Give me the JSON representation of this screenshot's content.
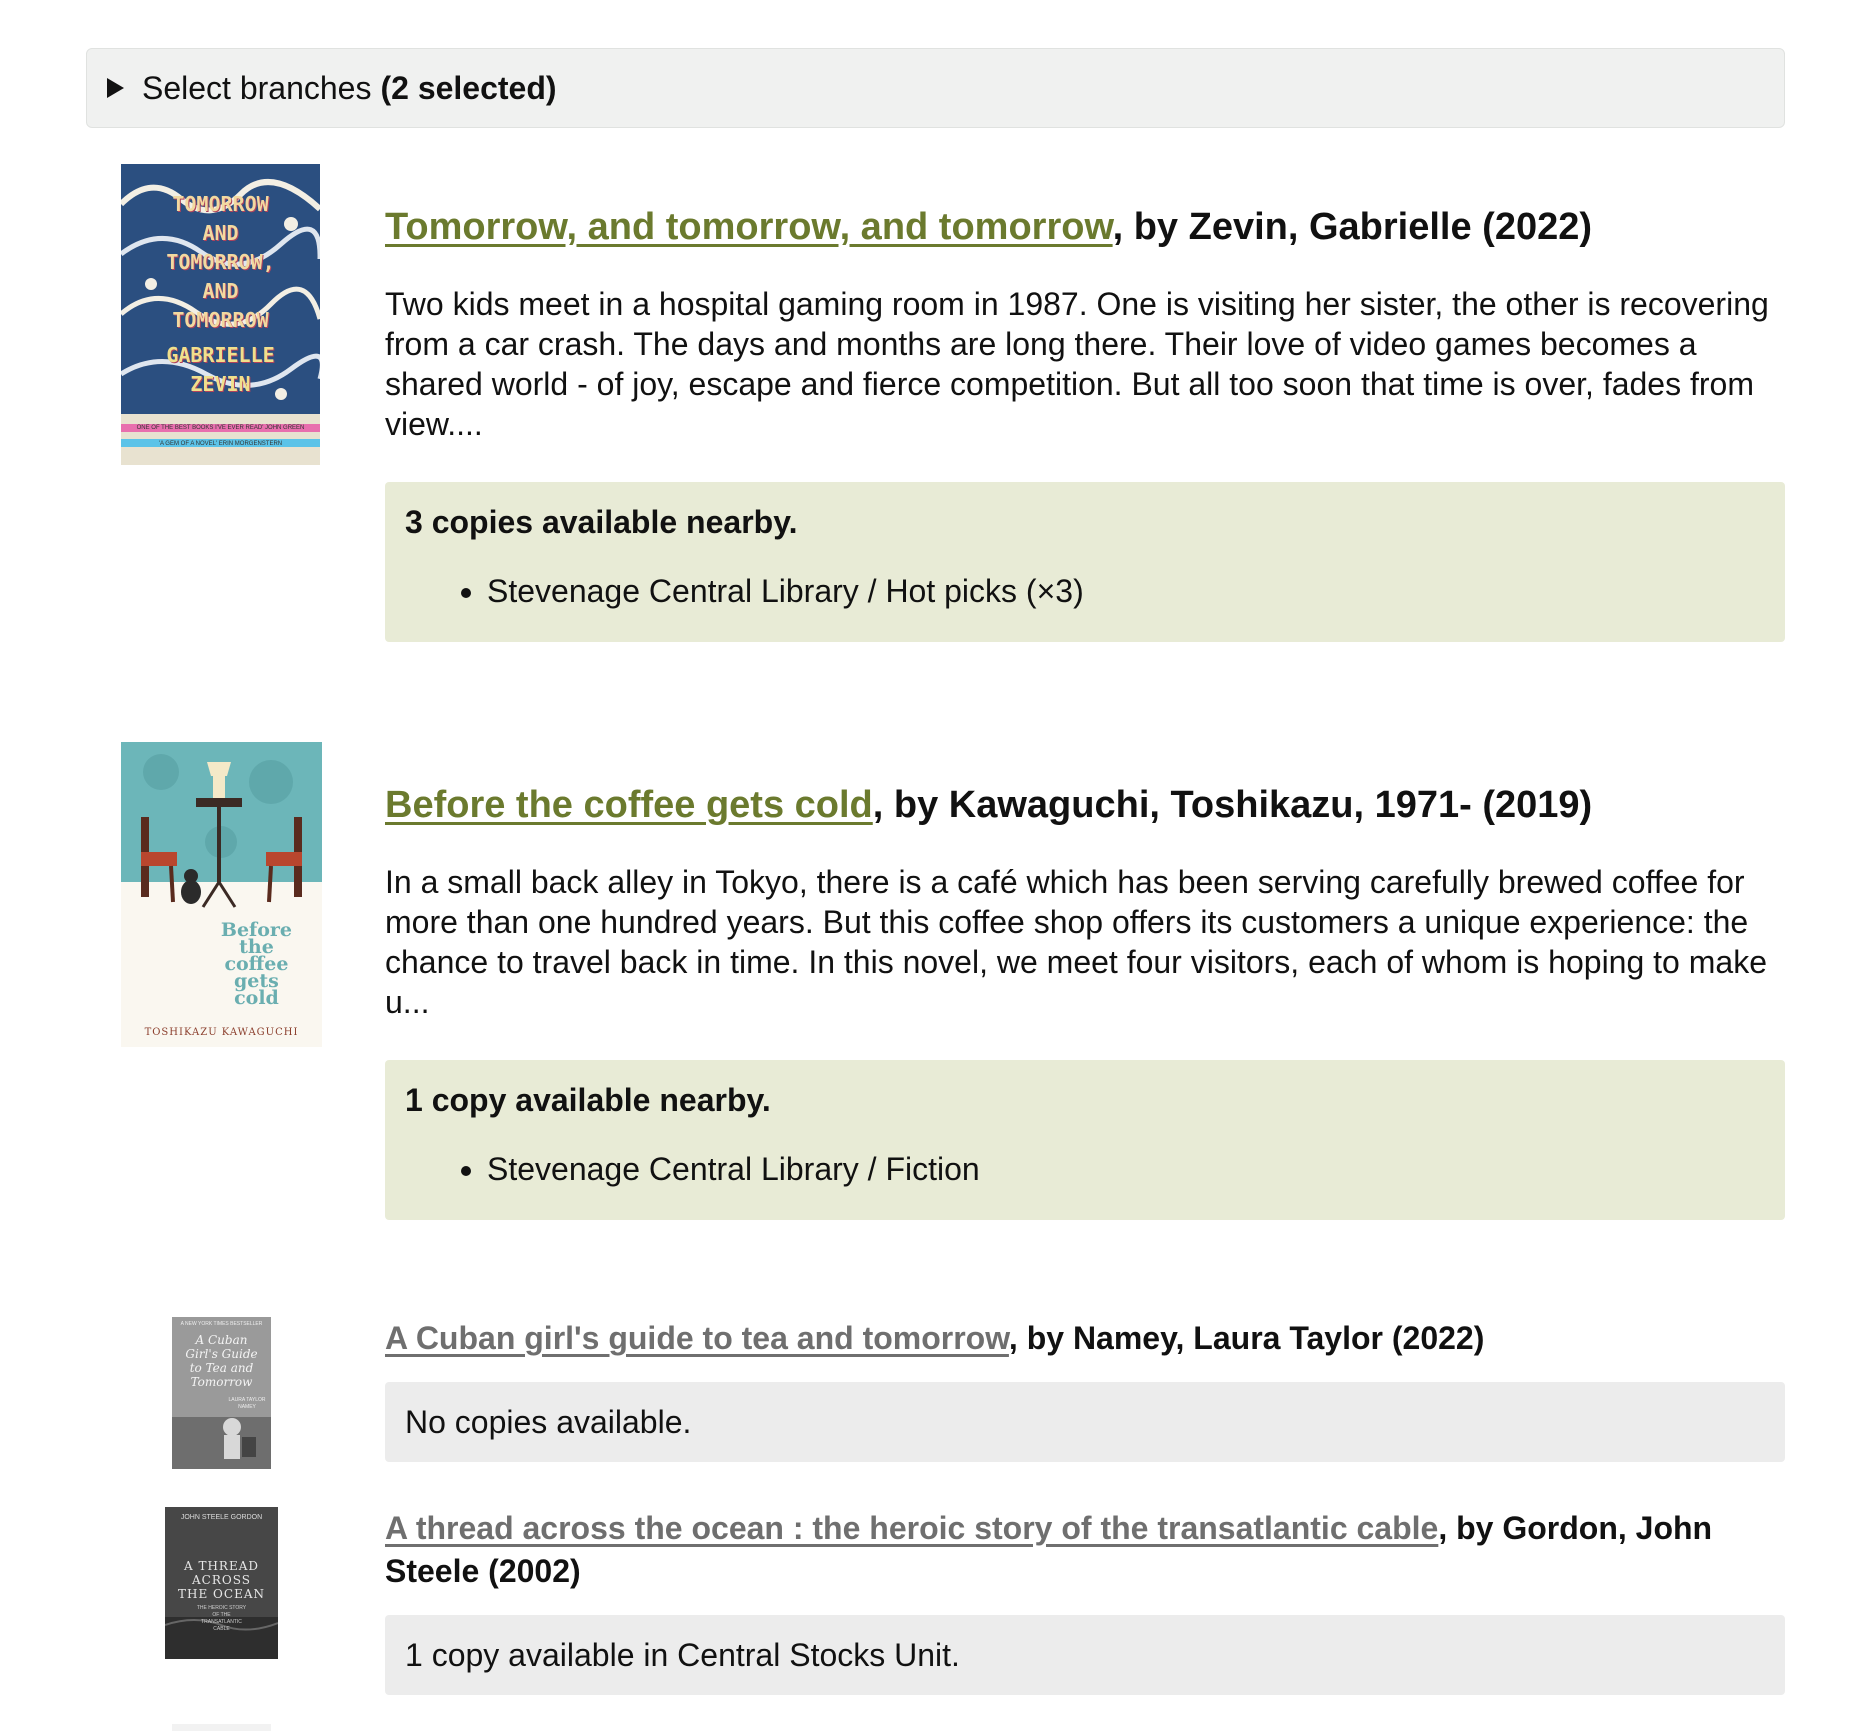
{
  "branches": {
    "label": "Select branches",
    "selected": "(2 selected)"
  },
  "results": [
    {
      "title": "Tomorrow, and tomorrow, and tomorrow",
      "byline": ", by Zevin, Gabrielle (2022)",
      "description": "Two kids meet in a hospital gaming room in 1987. One is visiting her sister, the other is recovering from a car crash. The days and months are long there. Their love of video games becomes a shared world - of joy, escape and fierce competition. But all too soon that time is over, fades from view....",
      "availability_heading": "3 copies available nearby.",
      "locations": [
        "Stevenage Central Library / Hot picks (×3)"
      ],
      "cover": {
        "lines": [
          "TOMORROW",
          "AND",
          "TOMORROW,",
          "AND",
          "TOMORROW"
        ],
        "author": [
          "GABRIELLE",
          "ZEVIN"
        ],
        "strip1": "ONE OF THE BEST BOOKS I'VE EVER READ' JOHN GREEN",
        "strip2": "'A GEM OF A NOVEL' ERIN MORGENSTERN"
      }
    },
    {
      "title": "Before the coffee gets cold",
      "byline": ", by Kawaguchi, Toshikazu, 1971- (2019)",
      "description": "In a small back alley in Tokyo, there is a café which has been serving carefully brewed coffee for more than one hundred years. But this coffee shop offers its customers a unique experience: the chance to travel back in time. In this novel, we meet four visitors, each of whom is hoping to make u...",
      "availability_heading": "1 copy available nearby.",
      "locations": [
        "Stevenage Central Library / Fiction"
      ],
      "cover": {
        "title_words": [
          "Before",
          "the",
          "coffee",
          "gets",
          "cold"
        ],
        "author": "TOSHIKAZU KAWAGUCHI"
      }
    },
    {
      "title": "A Cuban girl's guide to tea and tomorrow",
      "byline": ", by Namey, Laura Taylor (2022)",
      "availability_text": "No copies available.",
      "cover": {
        "tag": "A NEW YORK TIMES BESTSELLER",
        "title_words": [
          "A Cuban",
          "Girl's Guide",
          "to Tea and",
          "Tomorrow"
        ],
        "author": "LAURA TAYLOR NAMEY"
      }
    },
    {
      "title": "A thread across the ocean : the heroic story of the transatlantic cable",
      "byline": ", by Gordon, John Steele (2002)",
      "availability_text": "1 copy available in Central Stocks Unit.",
      "cover": {
        "author": "JOHN STEELE GORDON",
        "title_words": [
          "A THREAD",
          "ACROSS",
          "THE OCEAN"
        ],
        "subtitle_words": [
          "THE HEROIC STORY",
          "OF THE",
          "TRANSATLANTIC",
          "CABLE"
        ]
      }
    }
  ]
}
